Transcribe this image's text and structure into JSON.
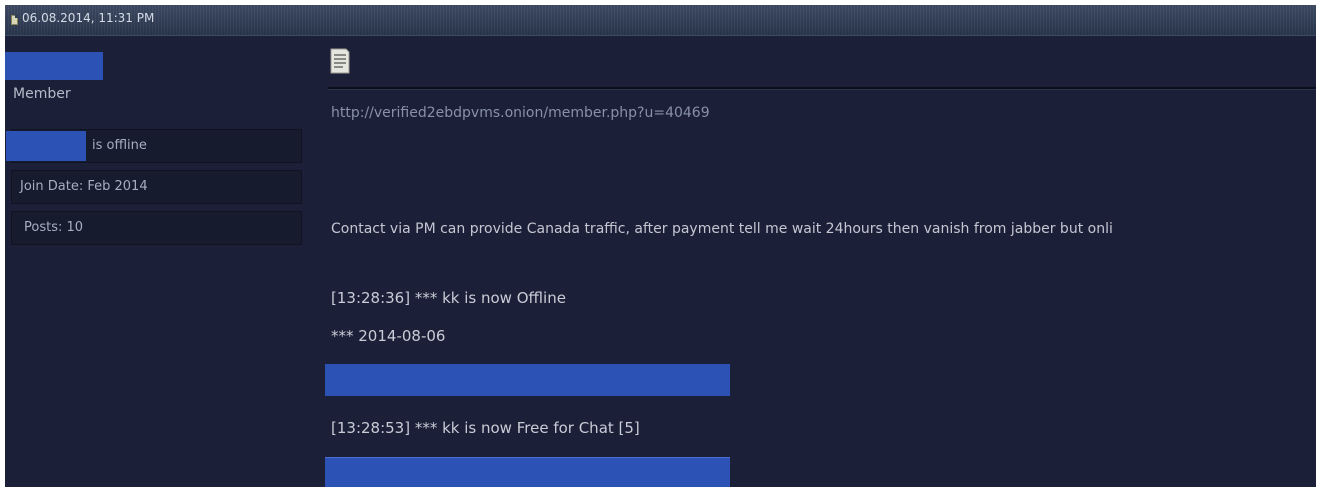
{
  "post": {
    "date": "06.08.2014, 11:31 PM"
  },
  "user": {
    "title": "Member",
    "status": "is offline",
    "join_date": "Join Date: Feb 2014",
    "posts": "Posts: 10"
  },
  "message": {
    "link": "http://verified2ebdpvms.onion/member.php?u=40469",
    "contact": "Contact via PM can provide Canada traffic, after payment tell me wait 24hours then vanish from jabber but onli",
    "log_offline": "[13:28:36] *** kk is now Offline",
    "log_date": "*** 2014-08-06",
    "log_free": "[13:28:53] *** kk is now Free for Chat [5]"
  },
  "icons": {
    "post": "post-status-icon",
    "message": "document-icon"
  },
  "colors": {
    "background": "#1b2038",
    "header": "#2f3d57",
    "redaction": "#2d52b5"
  }
}
